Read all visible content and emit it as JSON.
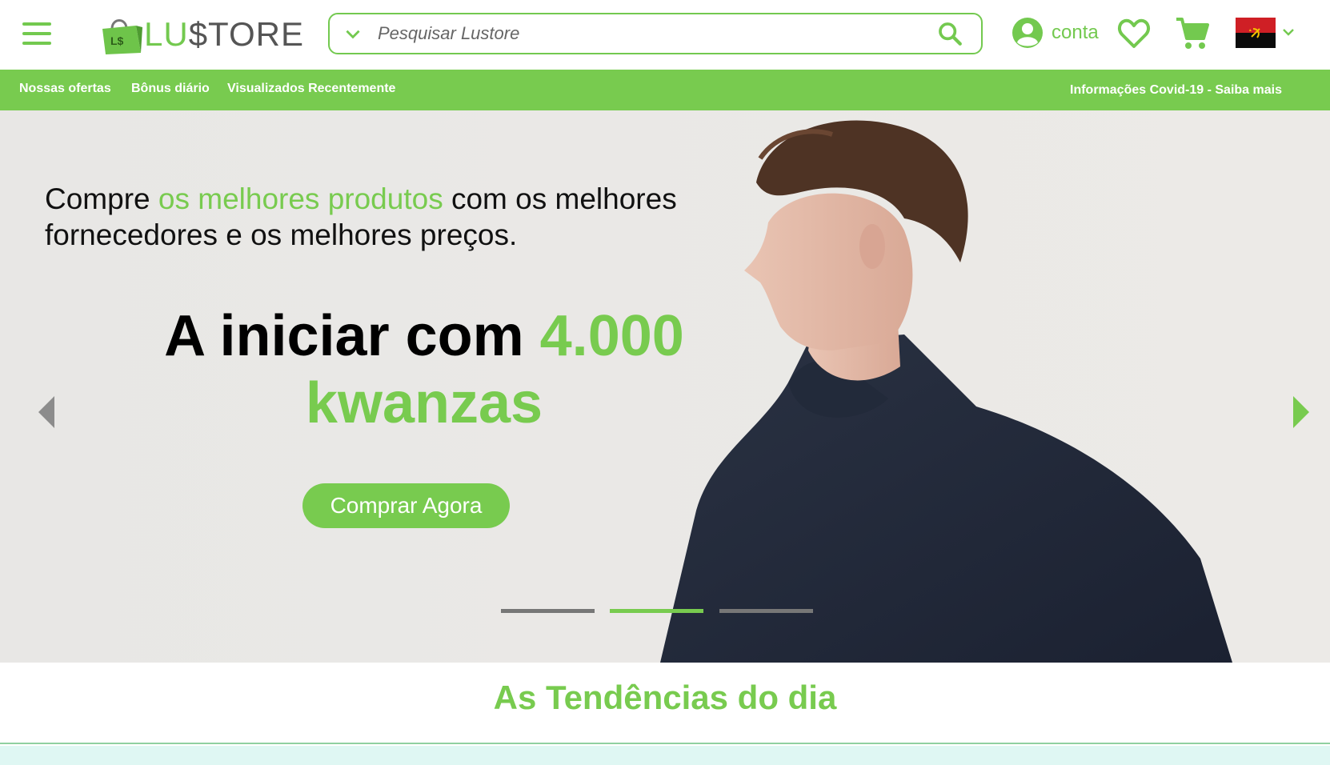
{
  "brand": {
    "logo_text_a": "LU",
    "logo_text_b": "$TORE",
    "accent": "#78cb4f"
  },
  "search": {
    "placeholder": "Pesquisar Lustore"
  },
  "header": {
    "account_label": "conta"
  },
  "navbar": {
    "items": [
      "Nossas ofertas",
      "Bônus diário",
      "Visualizados Recentemente"
    ],
    "right": "Informações Covid-19 - Saiba mais"
  },
  "hero": {
    "line_a": "Compre ",
    "line_hl": "os melhores produtos",
    "line_b": " com os melhores fornecedores e os melhores preços.",
    "big_a": "A iniciar com ",
    "big_hl": "4.000 kwanzas",
    "cta": "Comprar Agora",
    "slides_total": 3,
    "active_slide": 2
  },
  "trends": {
    "title": "As Tendências do dia"
  },
  "icons": [
    "menu-icon",
    "shopping-bag-icon",
    "chevron-down-icon",
    "search-icon",
    "user-icon",
    "heart-icon",
    "cart-icon",
    "angola-flag-icon",
    "chevron-left-icon",
    "chevron-right-icon"
  ]
}
